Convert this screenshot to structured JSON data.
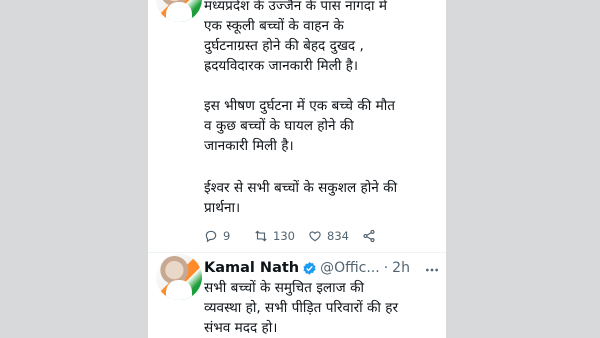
{
  "tweet1": {
    "para1": "मध्यप्रदेश के उज्जैन के पास नागदा में\nएक स्कूली बच्चों के वाहन के\nदुर्घटनाग्रस्त होने की बेहद दुखद ,\nह्रदयविदारक जानकारी मिली है।",
    "para2": "इस भीषण दुर्घटना में एक बच्चे की मौत\nव कुछ बच्चों के घायल होने की\nजानकारी मिली है।",
    "para3": "ईश्वर से सभी बच्चों के सकुशल होने की\nप्रार्थना।",
    "reply_count": "9",
    "retweet_count": "130",
    "like_count": "834"
  },
  "tweet2": {
    "name": "Kamal Nath",
    "handle": "@Offic...",
    "separator": "·",
    "time": "2h",
    "text": "सभी बच्चों के समुचित इलाज की\nव्यवस्था हो, सभी पीड़ित परिवारों की हर\nसंभव मदद हो।"
  },
  "colors": {
    "text": "#0f1419",
    "secondary": "#536471",
    "verified": "#1d9bf0"
  },
  "icons": [
    "reply-icon",
    "retweet-icon",
    "like-icon",
    "share-icon",
    "verified-icon",
    "more-icon"
  ]
}
